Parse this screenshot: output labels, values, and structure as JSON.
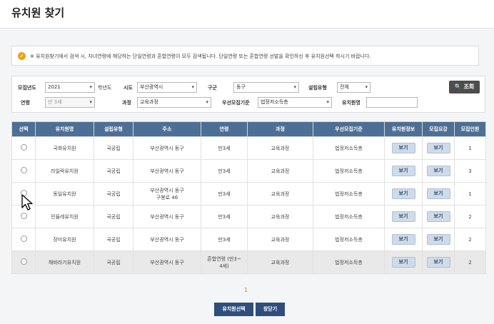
{
  "page": {
    "title": "유치원 찾기"
  },
  "notice": {
    "text": "※ 유치원찾기에서 검색 시, 자녀연령에 해당하는 단일연령과 혼합연령이 모두 검색됩니다. 단일연령 또는 혼합연령 선발을 확인하신 후 유치원선택 하시기 바랍니다."
  },
  "filters": {
    "year_label": "모집년도",
    "year_value": "2021",
    "year_suffix": "학년도",
    "city_label": "시도",
    "city_value": "부산광역시",
    "district_label": "구군",
    "district_value": "동구",
    "type_label": "설립유형",
    "type_value": "전체",
    "age_label": "연령",
    "age_value": "만 3세",
    "course_label": "과정",
    "course_value": "교육과정",
    "priority_label": "우선모집기준",
    "priority_value": "법정저소득층",
    "name_label": "유치원명",
    "name_value": "",
    "search_button": "조회"
  },
  "table": {
    "headers": [
      "선택",
      "유치원명",
      "설립유형",
      "주소",
      "연령",
      "과정",
      "우선모집기준",
      "유치원정보",
      "모집요강",
      "모집인원"
    ],
    "view_label": "보기",
    "rows": [
      {
        "name": "국화유치원",
        "type": "국공립",
        "addr1": "부산광역시 동구",
        "addr2": "",
        "age1": "만3세",
        "age2": "",
        "course": "교육과정",
        "priority": "법정저소득층",
        "count": "1"
      },
      {
        "name": "라일락유치원",
        "type": "국공립",
        "addr1": "부산광역시 동구",
        "addr2": "",
        "age1": "만3세",
        "age2": "",
        "course": "교육과정",
        "priority": "법정저소득층",
        "count": "3"
      },
      {
        "name": "동일유치원",
        "type": "국공립",
        "addr1": "부산광역시 동구",
        "addr2": "구봉로 46",
        "age1": "만3세",
        "age2": "",
        "course": "교육과정",
        "priority": "법정저소득층",
        "count": "1"
      },
      {
        "name": "민들레유치원",
        "type": "국공립",
        "addr1": "부산광역시 동구",
        "addr2": "",
        "age1": "만3세",
        "age2": "",
        "course": "교육과정",
        "priority": "법정저소득층",
        "count": "2"
      },
      {
        "name": "장미유치원",
        "type": "국공립",
        "addr1": "부산광역시 동구",
        "addr2": "",
        "age1": "만3세",
        "age2": "",
        "course": "교육과정",
        "priority": "법정저소득층",
        "count": "2"
      },
      {
        "name": "해바라기유치원",
        "type": "국공립",
        "addr1": "부산광역시 동구",
        "addr2": "",
        "age1": "혼합연령 (만3~",
        "age2": "4세)",
        "course": "교육과정",
        "priority": "법정저소득층",
        "count": "2"
      }
    ]
  },
  "pagination": {
    "current": "1"
  },
  "footer": {
    "select_button": "유치원선택",
    "close_button": "창닫기"
  }
}
